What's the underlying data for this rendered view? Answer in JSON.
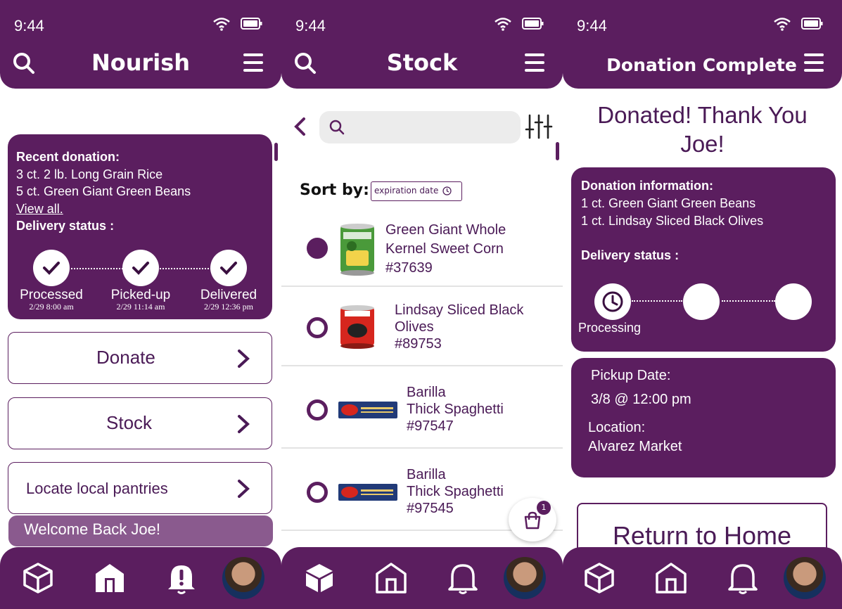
{
  "status_bar": {
    "time": "9:44"
  },
  "home": {
    "title": "Nourish",
    "recent": {
      "heading": "Recent donation:",
      "items": [
        "3 ct. 2 lb. Long Grain Rice",
        "5 ct. Green Giant Green Beans"
      ],
      "view_all": "View all.",
      "delivery_label": "Delivery status :"
    },
    "steps": [
      {
        "label": "Processed",
        "date": "2/29 8:00 am"
      },
      {
        "label": "Picked-up",
        "date": "2/29 11:14 am"
      },
      {
        "label": "Delivered",
        "date": "2/29 12:36 pm"
      }
    ],
    "buttons": {
      "donate": "Donate",
      "stock": "Stock",
      "locate": "Locate local pantries"
    },
    "welcome": "Welcome Back Joe!"
  },
  "stock": {
    "title": "Stock",
    "search_placeholder": "",
    "sort_label": "Sort by:",
    "sort_value": "expiration date",
    "items": [
      {
        "name1": "Green Giant Whole",
        "name2": "Kernel Sweet Corn",
        "id": "#37639",
        "selected": true,
        "image": "green-giant-can"
      },
      {
        "name1": "Lindsay Sliced Black",
        "name2": "Olives",
        "id": "#89753",
        "selected": false,
        "image": "lindsay-olives-can"
      },
      {
        "name1": "Barilla",
        "name2": "Thick Spaghetti",
        "id": "#97547",
        "selected": false,
        "image": "barilla-box"
      },
      {
        "name1": "Barilla",
        "name2": "Thick Spaghetti",
        "id": "#97545",
        "selected": false,
        "image": "barilla-box"
      }
    ],
    "cart_count": "1"
  },
  "complete": {
    "title": "Donation Complete",
    "thanks_line1": "Donated! Thank You",
    "thanks_line2": "Joe!",
    "info_heading": "Donation information:",
    "items": [
      "1 ct. Green Giant Green Beans",
      "1 ct. Lindsay Sliced Black Olives"
    ],
    "delivery_label": "Delivery status :",
    "step_label": "Processing",
    "pickup_label": "Pickup Date:",
    "pickup_value": "3/8 @ 12:00 pm",
    "location_label": "Location:",
    "location_value": "Alvarez Market",
    "return_label": "Return to Home"
  },
  "colors": {
    "primary": "#5b1e5f",
    "accent_light": "#8a5a8e",
    "text": "#4a1a56"
  },
  "icons": [
    "search-icon",
    "menu-icon",
    "wifi-icon",
    "battery-icon",
    "check-icon",
    "chevron-right-icon",
    "back-icon",
    "filter-icon",
    "clock-icon",
    "cart-icon",
    "box-icon",
    "home-icon",
    "bell-icon"
  ]
}
